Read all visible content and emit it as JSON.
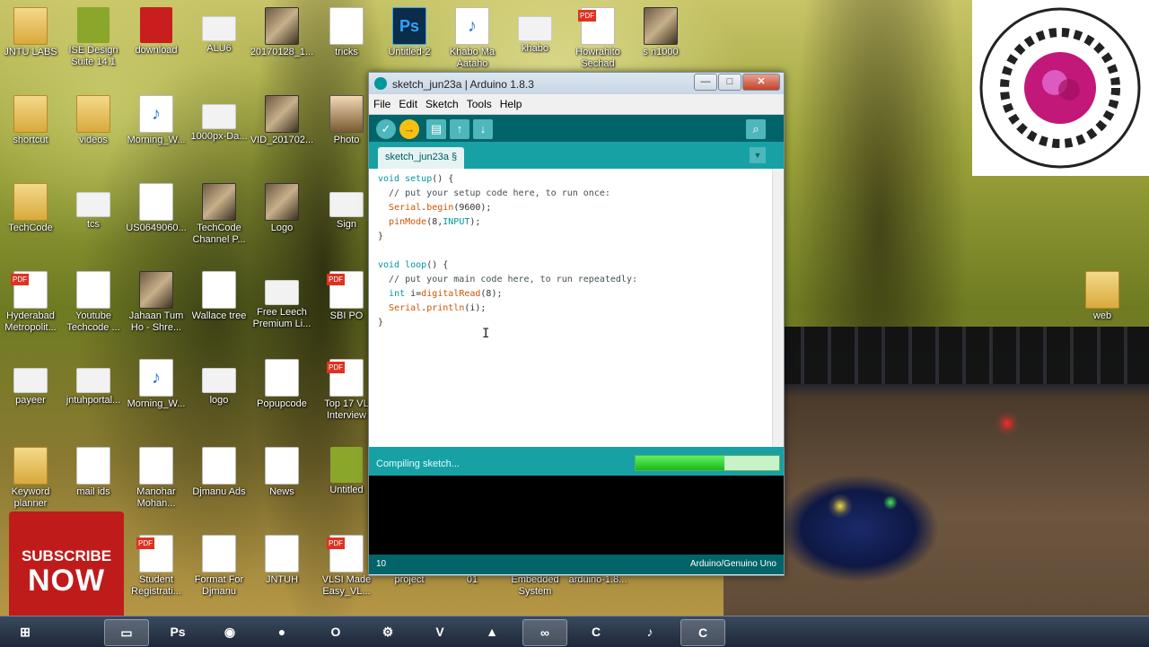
{
  "desktop_icons": [
    {
      "label": "JNTU LABS",
      "type": "folder"
    },
    {
      "label": "ISE Design Suite 14.1",
      "type": "green"
    },
    {
      "label": "download",
      "type": "red"
    },
    {
      "label": "ALU6",
      "type": "white"
    },
    {
      "label": "20170128_1...",
      "type": "thumb"
    },
    {
      "label": "tricks",
      "type": "doc"
    },
    {
      "label": "Untitled-2",
      "type": "ps"
    },
    {
      "label": "Khabo Ma Aataho",
      "type": "mp3"
    },
    {
      "label": "khabo",
      "type": "white"
    },
    {
      "label": "Howrahito Sechad",
      "type": "pdf"
    },
    {
      "label": "s n1000",
      "type": "thumb"
    },
    {
      "label": "shortcut",
      "type": "folder"
    },
    {
      "label": "videos",
      "type": "folder"
    },
    {
      "label": "Morning_W...",
      "type": "mp3"
    },
    {
      "label": "1000px-Da...",
      "type": "white"
    },
    {
      "label": "VID_201702...",
      "type": "thumb"
    },
    {
      "label": "Photo",
      "type": "person"
    },
    {
      "label": "TechCode",
      "type": "folder"
    },
    {
      "label": "tcs",
      "type": "white"
    },
    {
      "label": "US0649060...",
      "type": "doc"
    },
    {
      "label": "TechCode Channel P...",
      "type": "thumb"
    },
    {
      "label": "Logo",
      "type": "thumb"
    },
    {
      "label": "Sign",
      "type": "white"
    },
    {
      "label": "Hyderabad Metropolit...",
      "type": "pdf"
    },
    {
      "label": "Youtube Techcode ...",
      "type": "doc"
    },
    {
      "label": "Jahaan Tum Ho - Shre...",
      "type": "thumb"
    },
    {
      "label": "Wallace tree",
      "type": "doc"
    },
    {
      "label": "Free Leech Premium Li...",
      "type": "white"
    },
    {
      "label": "SBI PO",
      "type": "pdf"
    },
    {
      "label": "payeer",
      "type": "white"
    },
    {
      "label": "jntuhportal...",
      "type": "white"
    },
    {
      "label": "Morning_W...",
      "type": "mp3"
    },
    {
      "label": "logo",
      "type": "white"
    },
    {
      "label": "Popupcode",
      "type": "doc"
    },
    {
      "label": "Top 17 VL Interview",
      "type": "pdf"
    },
    {
      "label": "Keyword planner",
      "type": "folder"
    },
    {
      "label": "mail ids",
      "type": "doc"
    },
    {
      "label": "Manohar Mohan...",
      "type": "doc"
    },
    {
      "label": "Djmanu Ads",
      "type": "doc"
    },
    {
      "label": "News",
      "type": "doc"
    },
    {
      "label": "Untitled",
      "type": "green"
    },
    {
      "label": "Student Registrati...",
      "type": "pdf"
    },
    {
      "label": "Format For Djmanu",
      "type": "doc"
    },
    {
      "label": "JNTUH",
      "type": "doc"
    },
    {
      "label": "VLSI Made Easy_VL...",
      "type": "pdf"
    },
    {
      "label": "project",
      "type": "folder"
    },
    {
      "label": "01",
      "type": "folder"
    },
    {
      "label": "Embedded System",
      "type": "folder"
    },
    {
      "label": "arduino-1.8...",
      "type": "folder"
    },
    {
      "label": "web",
      "type": "folder"
    }
  ],
  "window": {
    "title": "sketch_jun23a | Arduino 1.8.3",
    "minimize": "—",
    "maximize": "□",
    "close": "✕",
    "menu": [
      "File",
      "Edit",
      "Sketch",
      "Tools",
      "Help"
    ],
    "toolbar": {
      "verify": "✓",
      "upload": "→",
      "new": "▤",
      "open": "↑",
      "save": "↓",
      "serial_monitor": "⌕"
    },
    "tab": "sketch_jun23a §",
    "tab_menu": "▼",
    "code": [
      [
        {
          "t": "void",
          "c": "kw"
        },
        {
          "t": " "
        },
        {
          "t": "setup",
          "c": "kw"
        },
        {
          "t": "() {"
        }
      ],
      [
        {
          "t": "  // put your setup code here, to run once:",
          "c": "cm"
        }
      ],
      [
        {
          "t": "  "
        },
        {
          "t": "Serial",
          "c": "fn"
        },
        {
          "t": "."
        },
        {
          "t": "begin",
          "c": "fn"
        },
        {
          "t": "(9600);"
        }
      ],
      [
        {
          "t": "  "
        },
        {
          "t": "pinMode",
          "c": "fn"
        },
        {
          "t": "(8,"
        },
        {
          "t": "INPUT",
          "c": "cst"
        },
        {
          "t": ");"
        }
      ],
      [
        {
          "t": "}"
        }
      ],
      [
        {
          "t": ""
        }
      ],
      [
        {
          "t": "void",
          "c": "kw"
        },
        {
          "t": " "
        },
        {
          "t": "loop",
          "c": "kw"
        },
        {
          "t": "() {"
        }
      ],
      [
        {
          "t": "  // put your main code here, to run repeatedly:",
          "c": "cm"
        }
      ],
      [
        {
          "t": "  "
        },
        {
          "t": "int",
          "c": "kw"
        },
        {
          "t": " i="
        },
        {
          "t": "digitalRead",
          "c": "fn"
        },
        {
          "t": "(8);"
        }
      ],
      [
        {
          "t": "  "
        },
        {
          "t": "Serial",
          "c": "fn"
        },
        {
          "t": "."
        },
        {
          "t": "println",
          "c": "fn"
        },
        {
          "t": "(i);"
        }
      ],
      [
        {
          "t": "}"
        }
      ]
    ],
    "status": "Compiling sketch...",
    "progress": 0.62,
    "line_number": "10",
    "board": "Arduino/Genuino Uno"
  },
  "subscribe": {
    "line1": "SUBSCRIBE",
    "line2": "NOW"
  },
  "taskbar": [
    {
      "name": "start-button",
      "glyph": "⊞"
    },
    {
      "name": "explorer-taskbar-button",
      "glyph": "▭"
    },
    {
      "name": "photoshop-taskbar-button",
      "glyph": "Ps"
    },
    {
      "name": "chrome-taskbar-button",
      "glyph": "◉"
    },
    {
      "name": "firefox-taskbar-button",
      "glyph": "●"
    },
    {
      "name": "opera-taskbar-button",
      "glyph": "O"
    },
    {
      "name": "app-taskbar-button",
      "glyph": "⚙"
    },
    {
      "name": "vivaldi-taskbar-button",
      "glyph": "V"
    },
    {
      "name": "brave-taskbar-button",
      "glyph": "▲"
    },
    {
      "name": "arduino-taskbar-button",
      "glyph": "∞"
    },
    {
      "name": "camtasia-taskbar-button",
      "glyph": "C"
    },
    {
      "name": "audio-taskbar-button",
      "glyph": "♪"
    },
    {
      "name": "camtasia-recorder-taskbar-button",
      "glyph": "C"
    }
  ],
  "logo_text": {
    "top": "JAWAHARLAL NEHRU TECHNOLOGICAL UNIVERSITY",
    "bottom": "HYDERABAD"
  },
  "colors": {
    "arduino_teal": "#00979d",
    "arduino_dark": "#006468",
    "progress": "#1cb81c",
    "subscribe": "#c01b1b"
  }
}
